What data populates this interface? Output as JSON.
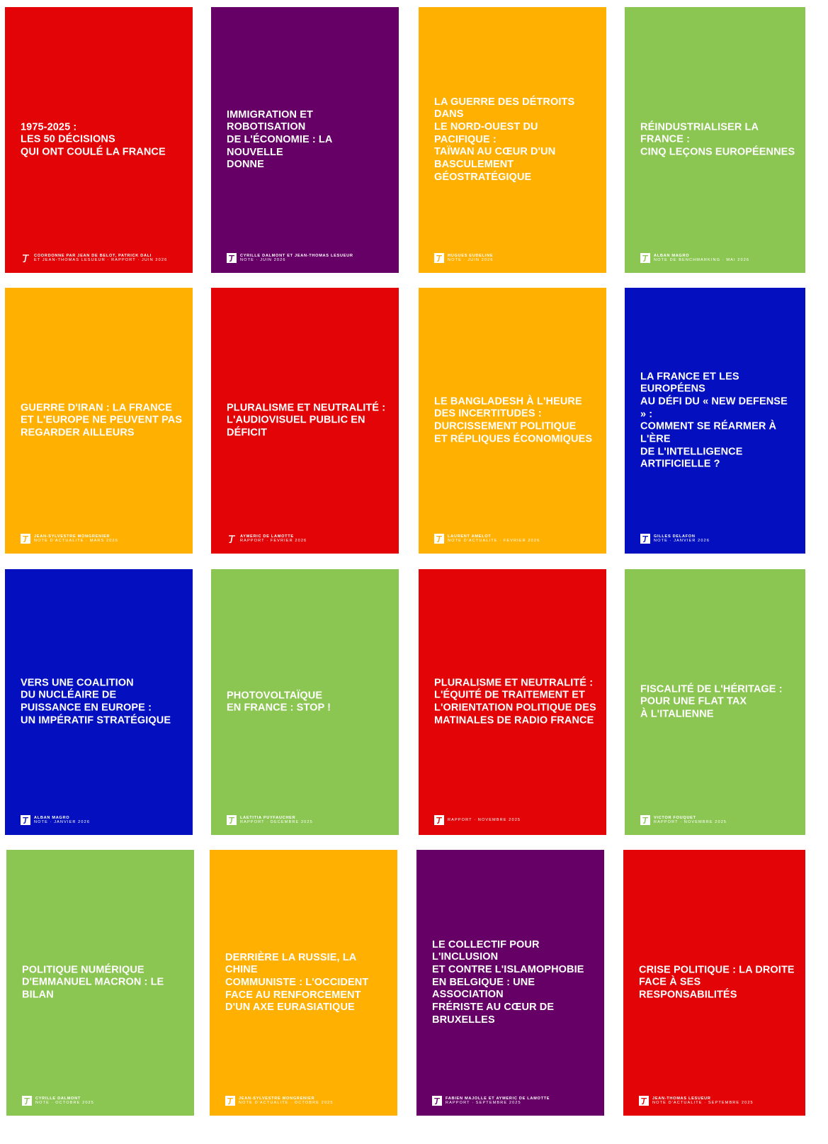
{
  "colors": {
    "red": "#E20406",
    "purple": "#660066",
    "yellow": "#FFB001",
    "green": "#8CC652",
    "blue": "#0410BF"
  },
  "publications": [
    {
      "title": "1975-2025 :\nLES 50 DÉCISIONS\nQUI ONT COULÉ LA FRANCE",
      "author": "COORDONNÉ PAR JEAN DE BELOT, PATRICK DALI",
      "meta": "ET JEAN-THOMAS LESUEUR · RAPPORT · JUIN 2026",
      "color": "#E20406",
      "logo": "italic-f-logo-icon"
    },
    {
      "title": "IMMIGRATION ET ROBOTISATION\nDE L'ÉCONOMIE : LA NOUVELLE\nDONNE",
      "author": "CYRILLE DALMONT ET JEAN-THOMAS LESUEUR",
      "meta": "NOTE · JUIN 2026",
      "color": "#660066",
      "logo": "square-f-logo-icon"
    },
    {
      "title": "LA GUERRE DES DÉTROITS DANS\nLE NORD-OUEST DU PACIFIQUE :\nTAÏWAN AU CŒUR D'UN\nBASCULEMENT GÉOSTRATÉGIQUE",
      "author": "HUGUES EUDELINE",
      "meta": "NOTE · JUIN 2026",
      "color": "#FFB001",
      "logo": "square-f-logo-icon"
    },
    {
      "title": "RÉINDUSTRIALISER LA FRANCE :\nCINQ LEÇONS EUROPÉENNES",
      "author": "ALBAN MAGRO",
      "meta": "NOTE DE BENCHMARKING · MAI 2026",
      "color": "#8CC652",
      "logo": "square-f-logo-icon"
    },
    {
      "title": "GUERRE D'IRAN : LA FRANCE\nET L'EUROPE NE PEUVENT PAS\nREGARDER AILLEURS",
      "author": "JEAN-SYLVESTRE MONGRENIER",
      "meta": "NOTE D'ACTUALITÉ · MARS 2026",
      "color": "#FFB001",
      "logo": "square-f-logo-icon"
    },
    {
      "title": "PLURALISME ET NEUTRALITÉ :\nL'AUDIOVISUEL PUBLIC EN DÉFICIT",
      "author": "AYMERIC DE LAMOTTE",
      "meta": "RAPPORT · FÉVRIER 2026",
      "color": "#E20406",
      "logo": "italic-f-logo-icon"
    },
    {
      "title": "LE BANGLADESH À L'HEURE\nDES INCERTITUDES :\nDURCISSEMENT POLITIQUE\nET RÉPLIQUES ÉCONOMIQUES",
      "author": "LAURENT AMELOT",
      "meta": "NOTE D'ACTUALITÉ · FÉVRIER 2026",
      "color": "#FFB001",
      "logo": "square-f-logo-icon"
    },
    {
      "title": "LA FRANCE ET LES EUROPÉENS\nAU DÉFI DU « NEW DEFENSE » :\nCOMMENT SE RÉARMER À L'ÈRE\nDE L'INTELLIGENCE ARTIFICIELLE ?",
      "author": "GILLES DELAFON",
      "meta": "NOTE · JANVIER 2026",
      "color": "#0410BF",
      "logo": "square-f-logo-icon"
    },
    {
      "title": "VERS UNE COALITION\nDU NUCLÉAIRE DE\nPUISSANCE EN EUROPE :\nUN IMPÉRATIF STRATÉGIQUE",
      "author": "ALBAN MAGRO",
      "meta": "NOTE · JANVIER 2026",
      "color": "#0410BF",
      "logo": "square-f-logo-icon"
    },
    {
      "title": "PHOTOVOLTAÏQUE\nEN FRANCE : STOP !",
      "author": "LAETITIA PUYFAUCHER",
      "meta": "RAPPORT · DÉCEMBRE 2025",
      "color": "#8CC652",
      "logo": "square-f-logo-icon"
    },
    {
      "title": "PLURALISME ET NEUTRALITÉ :\nL'ÉQUITÉ DE TRAITEMENT ET\nL'ORIENTATION POLITIQUE DES\nMATINALES DE RADIO FRANCE",
      "author": "",
      "meta": "RAPPORT · NOVEMBRE 2025",
      "color": "#E20406",
      "logo": "square-f-logo-icon"
    },
    {
      "title": "FISCALITÉ DE L'HÉRITAGE :\nPOUR UNE FLAT TAX\nÀ L'ITALIENNE",
      "author": "VICTOR FOUQUET",
      "meta": "RAPPORT · NOVEMBRE 2025",
      "color": "#8CC652",
      "logo": "square-f-logo-icon"
    },
    {
      "title": "POLITIQUE NUMÉRIQUE\nD'EMMANUEL MACRON : LE BILAN",
      "author": "CYRILLE DALMONT",
      "meta": "NOTE · OCTOBRE 2025",
      "color": "#8CC652",
      "logo": "square-f-logo-icon"
    },
    {
      "title": "DERRIÈRE LA RUSSIE, LA CHINE\nCOMMUNISTE : L'OCCIDENT\nFACE AU RENFORCEMENT\nD'UN AXE EURASIATIQUE",
      "author": "JEAN-SYLVESTRE MONGRENIER",
      "meta": "NOTE D'ACTUALITÉ · OCTOBRE 2025",
      "color": "#FFB001",
      "logo": "square-f-logo-icon"
    },
    {
      "title": "LE COLLECTIF POUR L'INCLUSION\nET CONTRE L'ISLAMOPHOBIE\nEN BELGIQUE : UNE ASSOCIATION\nFRÉRISTE AU CŒUR DE BRUXELLES",
      "author": "FABIEN MAJOLLE ET AYMERIC DE LAMOTTE",
      "meta": "RAPPORT · SEPTEMBRE 2025",
      "color": "#660066",
      "logo": "square-f-logo-icon"
    },
    {
      "title": "CRISE POLITIQUE : LA DROITE\nFACE À SES RESPONSABILITÉS",
      "author": "JEAN-THOMAS LESUEUR",
      "meta": "NOTE D'ACTUALITÉ · SEPTEMBRE 2025",
      "color": "#E20406",
      "logo": "square-f-logo-icon"
    }
  ]
}
